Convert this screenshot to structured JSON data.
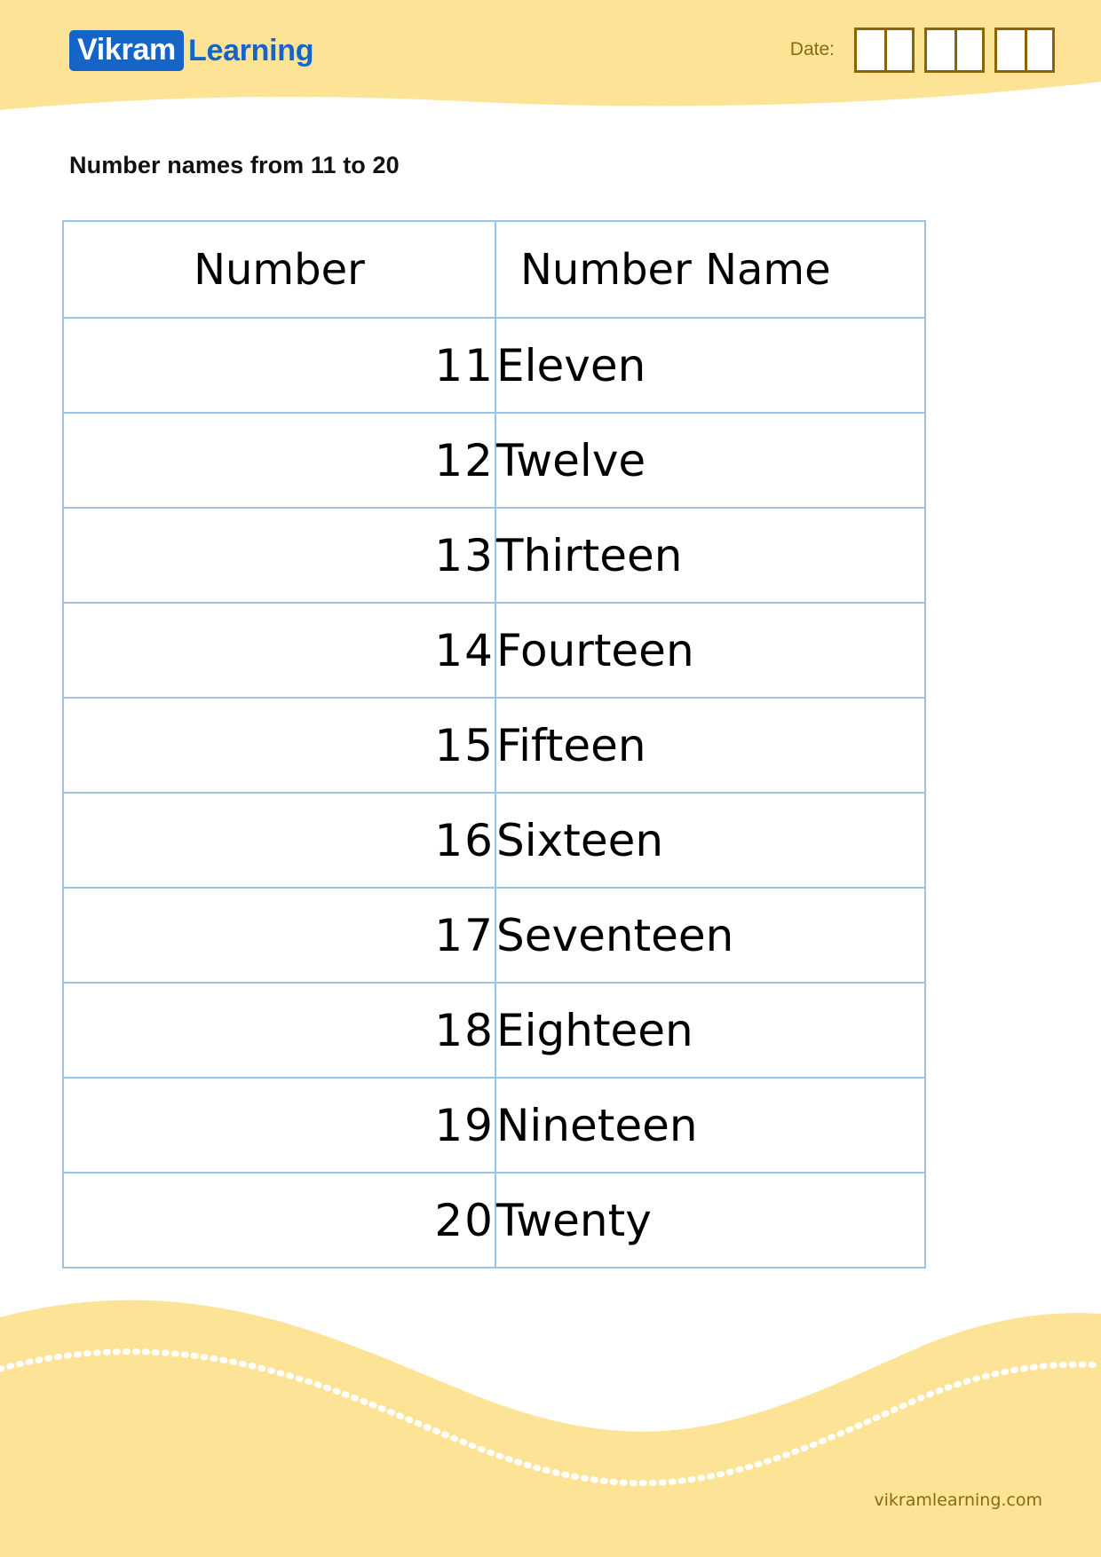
{
  "brand": {
    "logo_mark": "Vikram",
    "logo_text": "Learning",
    "logo_color": "#1565c8",
    "footer_url": "vikramlearning.com",
    "footer_text_color": "#8a6a14"
  },
  "header": {
    "band_color": "#fce396",
    "date_label": "Date:",
    "date_box_groups": 3,
    "date_boxes_per_group": 2,
    "date_box_border_color": "#8a6505"
  },
  "title": "Number names from 11 to 20",
  "table": {
    "border_color": "#9cc3e5",
    "columns": [
      "Number",
      "Number Name"
    ],
    "rows": [
      {
        "number": "11",
        "name": "Eleven"
      },
      {
        "number": "12",
        "name": "Twelve"
      },
      {
        "number": "13",
        "name": "Thirteen"
      },
      {
        "number": "14",
        "name": "Fourteen"
      },
      {
        "number": "15",
        "name": "Fifteen"
      },
      {
        "number": "16",
        "name": "Sixteen"
      },
      {
        "number": "17",
        "name": "Seventeen"
      },
      {
        "number": "18",
        "name": "Eighteen"
      },
      {
        "number": "19",
        "name": "Nineteen"
      },
      {
        "number": "20",
        "name": "Twenty"
      }
    ]
  }
}
